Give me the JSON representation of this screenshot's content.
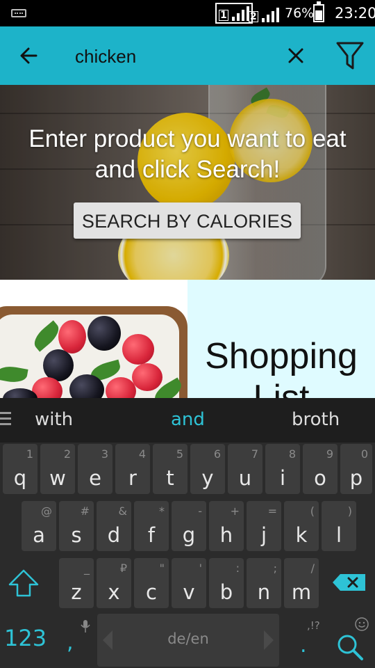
{
  "status_bar": {
    "sim1_label": "1",
    "sim2_label": "2",
    "battery": "76%",
    "time": "23:20"
  },
  "app_bar": {
    "search_value": "chicken",
    "back_icon": "arrow-left-icon",
    "clear_icon": "close-icon",
    "filter_icon": "filter-icon",
    "bg_color": "#1db3c9"
  },
  "hero": {
    "message_line1": "Enter product you want to eat",
    "message_line2": "and click Search!",
    "button_label": "SEARCH BY CALORIES"
  },
  "cards": {
    "shopping_title": "Shopping List",
    "shopping_bg": "#dffbff"
  },
  "keyboard": {
    "suggestions": [
      "with",
      "and",
      "broth"
    ],
    "row1": [
      {
        "key": "q",
        "alt": "1"
      },
      {
        "key": "w",
        "alt": "2"
      },
      {
        "key": "e",
        "alt": "3"
      },
      {
        "key": "r",
        "alt": "4"
      },
      {
        "key": "t",
        "alt": "5"
      },
      {
        "key": "y",
        "alt": "6"
      },
      {
        "key": "u",
        "alt": "7"
      },
      {
        "key": "i",
        "alt": "8"
      },
      {
        "key": "o",
        "alt": "9"
      },
      {
        "key": "p",
        "alt": "0"
      }
    ],
    "row2": [
      {
        "key": "a",
        "alt": "@"
      },
      {
        "key": "s",
        "alt": "#"
      },
      {
        "key": "d",
        "alt": "&"
      },
      {
        "key": "f",
        "alt": "*"
      },
      {
        "key": "g",
        "alt": "-"
      },
      {
        "key": "h",
        "alt": "+"
      },
      {
        "key": "j",
        "alt": "="
      },
      {
        "key": "k",
        "alt": "("
      },
      {
        "key": "l",
        "alt": ")"
      }
    ],
    "row3": [
      {
        "key": "z",
        "alt": "_"
      },
      {
        "key": "x",
        "alt": "₽"
      },
      {
        "key": "c",
        "alt": "\""
      },
      {
        "key": "v",
        "alt": "'"
      },
      {
        "key": "b",
        "alt": ":"
      },
      {
        "key": "n",
        "alt": ";"
      },
      {
        "key": "m",
        "alt": "/"
      }
    ],
    "numbers_key": "123",
    "comma_key": ",",
    "period_key": ".",
    "period_alt": ",!?",
    "space_label": "de/en",
    "accent_color": "#2ec3d6"
  }
}
